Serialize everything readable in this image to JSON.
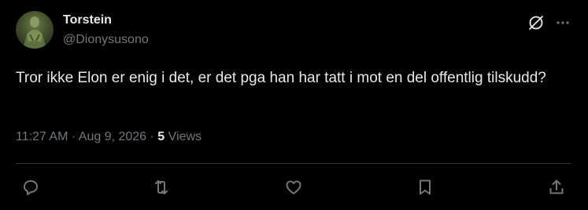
{
  "author": {
    "name": "Torstein",
    "handle": "@Dionysusono"
  },
  "tweet": {
    "text": "Tror ikke Elon er enig i det, er det pga han har tatt i mot en del offentlig tilskudd?",
    "time": "11:27 AM",
    "separator1": " · ",
    "date": "Aug 9, 2026",
    "separator2": " · ",
    "views_count": "5",
    "views_label": " Views"
  },
  "icons": {
    "top_right": [
      "grok-icon",
      "more-icon"
    ],
    "actions": [
      "reply-icon",
      "repost-icon",
      "like-icon",
      "bookmark-icon",
      "share-icon"
    ]
  },
  "colors": {
    "background": "#000000",
    "primary_text": "#e7e9ea",
    "secondary_text": "#71767b",
    "divider": "#2f3336"
  }
}
